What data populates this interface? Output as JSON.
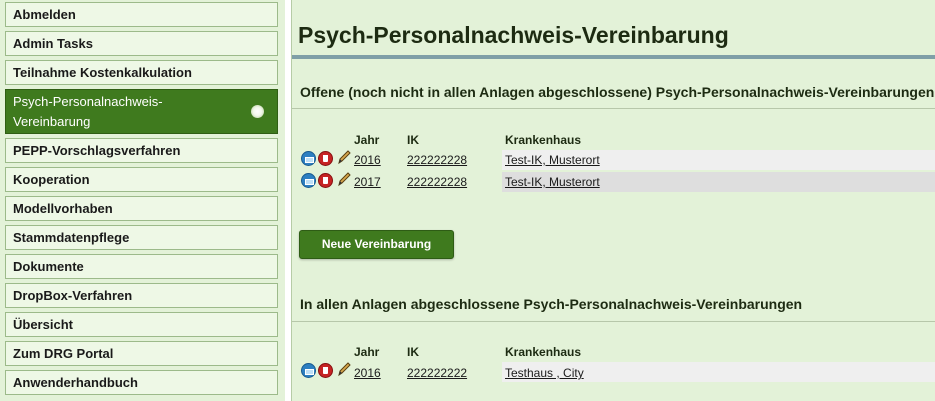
{
  "nav": {
    "items": [
      {
        "label": "Abmelden"
      },
      {
        "label": "Admin Tasks"
      },
      {
        "label": "Teilnahme Kostenkalkulation"
      },
      {
        "label": "Psych-Personalnachweis-Vereinbarung",
        "active": true
      },
      {
        "label": "PEPP-Vorschlagsverfahren"
      },
      {
        "label": "Kooperation"
      },
      {
        "label": "Modellvorhaben"
      },
      {
        "label": "Stammdatenpflege"
      },
      {
        "label": "Dokumente"
      },
      {
        "label": "DropBox-Verfahren"
      },
      {
        "label": "Übersicht"
      },
      {
        "label": "Zum DRG Portal"
      },
      {
        "label": "Anwenderhandbuch"
      }
    ]
  },
  "main": {
    "title": "Psych-Personalnachweis-Vereinbarung",
    "open_section": {
      "title": "Offene (noch nicht in allen Anlagen abgeschlossene) Psych-Personalnachweis-Vereinbarungen",
      "columns": [
        "Jahr",
        "IK",
        "Krankenhaus"
      ],
      "rows": [
        {
          "jahr": "2016",
          "ik": "222222228",
          "krankenhaus": "Test-IK, Musterort"
        },
        {
          "jahr": "2017",
          "ik": "222222228",
          "krankenhaus": "Test-IK, Musterort"
        }
      ]
    },
    "new_button_label": "Neue Vereinbarung",
    "closed_section": {
      "title": "In allen Anlagen abgeschlossene Psych-Personalnachweis-Vereinbarungen",
      "columns": [
        "Jahr",
        "IK",
        "Krankenhaus"
      ],
      "rows": [
        {
          "jahr": "2016",
          "ik": "222222222",
          "krankenhaus": "Testhaus , City"
        }
      ]
    }
  },
  "icons": {
    "print": "print-icon",
    "delete": "delete-icon",
    "edit": "pencil-icon"
  },
  "colors": {
    "accent_green": "#3f7a1e",
    "panel_bg": "#e3f2d8",
    "nav_item_bg": "#eef8e6"
  }
}
